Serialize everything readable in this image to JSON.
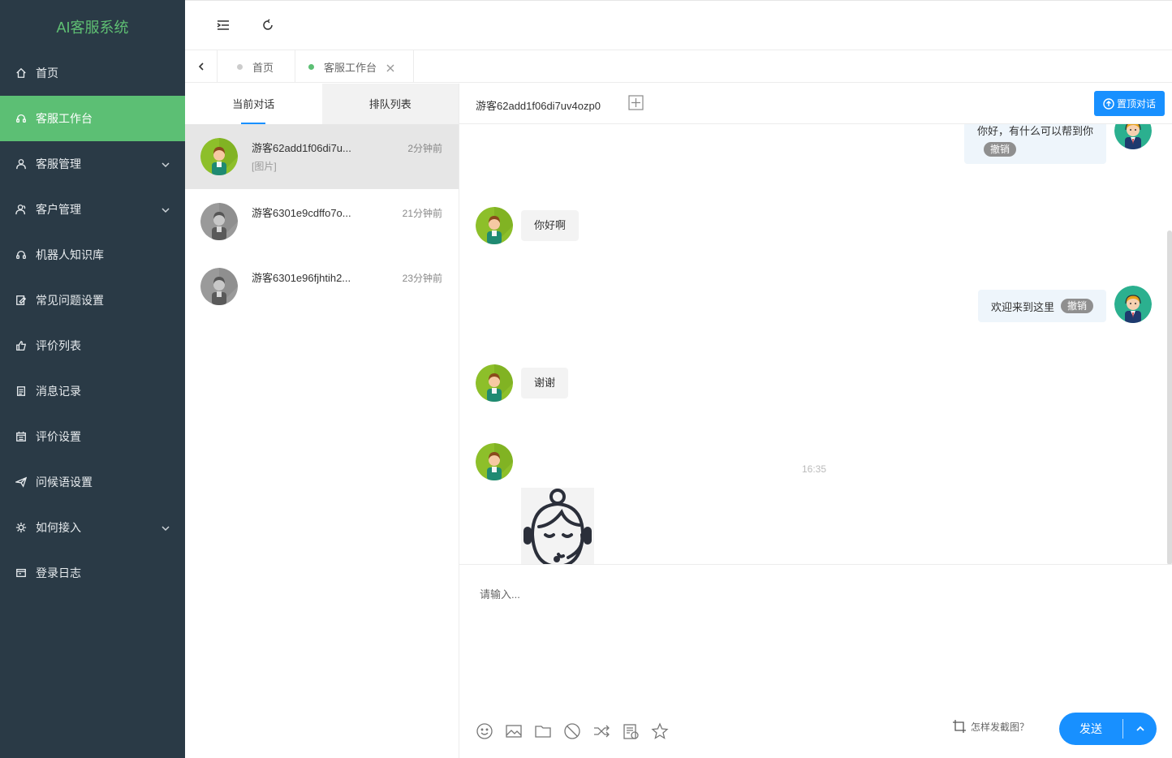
{
  "app": {
    "title": "AI客服系统"
  },
  "sidebar": {
    "items": [
      {
        "label": "首页",
        "icon": "home-icon"
      },
      {
        "label": "客服工作台",
        "icon": "headset-icon",
        "active": true
      },
      {
        "label": "客服管理",
        "icon": "user-icon",
        "expandable": true
      },
      {
        "label": "客户管理",
        "icon": "users-icon",
        "expandable": true
      },
      {
        "label": "机器人知识库",
        "icon": "robot-icon"
      },
      {
        "label": "常见问题设置",
        "icon": "edit-doc-icon"
      },
      {
        "label": "评价列表",
        "icon": "thumbs-up-icon"
      },
      {
        "label": "消息记录",
        "icon": "record-icon"
      },
      {
        "label": "评价设置",
        "icon": "calendar-icon"
      },
      {
        "label": "问候语设置",
        "icon": "send-icon"
      },
      {
        "label": "如何接入",
        "icon": "link-icon",
        "expandable": true
      },
      {
        "label": "登录日志",
        "icon": "log-icon"
      }
    ]
  },
  "topbar": {
    "fold_icon": "fold-menu-icon",
    "refresh_icon": "refresh-icon"
  },
  "tabs": [
    {
      "label": "首页",
      "active": false
    },
    {
      "label": "客服工作台",
      "active": true,
      "closable": true
    }
  ],
  "conversations": {
    "tabs": [
      "当前对话",
      "排队列表"
    ],
    "items": [
      {
        "name": "游客62add1f06di7u...",
        "time": "2分钟前",
        "preview": "[图片]",
        "selected": true,
        "avatar": "green"
      },
      {
        "name": "游客6301e9cdffo7o...",
        "time": "21分钟前",
        "preview": "",
        "selected": false,
        "avatar": "gray"
      },
      {
        "name": "游客6301e96fjhtih2...",
        "time": "23分钟前",
        "preview": "",
        "selected": false,
        "avatar": "gray"
      }
    ]
  },
  "chat": {
    "title": "游客62add1f06di7uv4ozp0",
    "pin_button": "置顶对话",
    "messages": [
      {
        "side": "right",
        "text": "你好，有什么可以帮到你",
        "revoke": "撤销"
      },
      {
        "side": "left",
        "text": "你好啊"
      },
      {
        "side": "right",
        "text": "欢迎来到这里",
        "revoke": "撤销"
      },
      {
        "side": "left",
        "text": "谢谢"
      },
      {
        "side": "left",
        "type": "image",
        "image": "headset-agent-face"
      }
    ],
    "timestamp": "16:35",
    "input_placeholder": "请输入...",
    "screenshot_help": "怎样发截图？",
    "send_label": "发送",
    "toolbar_icons": [
      "emoji-icon",
      "image-icon",
      "folder-icon",
      "ban-icon",
      "transfer-icon",
      "note-icon",
      "star-icon"
    ]
  },
  "colors": {
    "sidebar_bg": "#2a3a46",
    "accent_green": "#5cbf74",
    "primary_blue": "#1890ff"
  }
}
